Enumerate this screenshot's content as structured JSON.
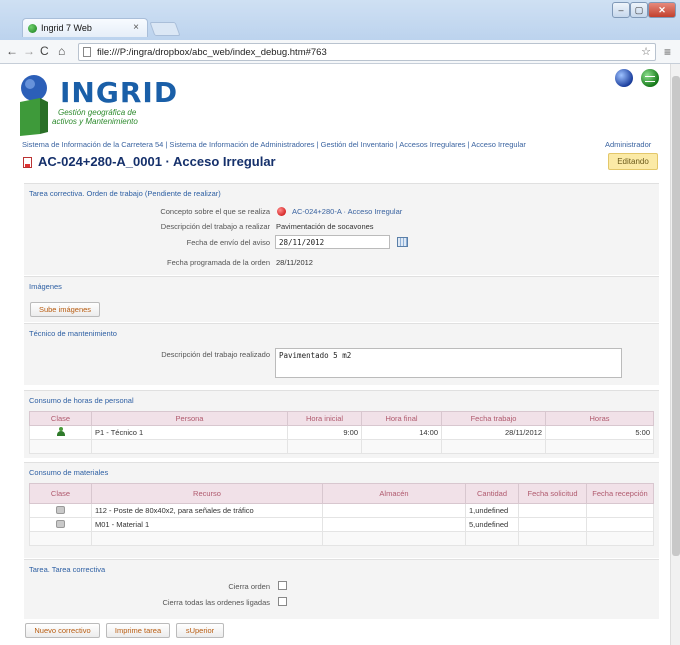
{
  "browser": {
    "tab_title": "Ingrid 7 Web",
    "tab_close": "×",
    "url": "file:///P:/ingra/dropbox/abc_web/index_debug.htm#763",
    "window_min": "–",
    "window_max": "▢",
    "window_close": "✕"
  },
  "header": {
    "logo_text": "INGRID",
    "logo_sub1": "Gestión geográfica de",
    "logo_sub2": "activos y Mantenimiento",
    "breadcrumb": "Sistema de Información de la Carretera 54 | Sistema de Información de Administradores | Gestión del Inventario | Accesos Irregulares | Acceso Irregular",
    "user": "Administrador",
    "title": "AC-024+280-A_0001 · Acceso Irregular",
    "status": "Editando"
  },
  "tarea": {
    "section_title": "Tarea correctiva. Orden de trabajo (Pendiente de realizar)",
    "concepto_label": "Concepto sobre el que se realiza",
    "concepto_value": "AC-024+280-A · Acceso Irregular",
    "descripcion_label": "Descripción del trabajo a realizar",
    "descripcion_value": "Pavimentación de socavones",
    "fecha_envio_label": "Fecha de envío del aviso",
    "fecha_envio_value": "28/11/2012",
    "fecha_prog_label": "Fecha programada de la orden",
    "fecha_prog_value": "28/11/2012"
  },
  "imagenes": {
    "section_title": "Imágenes",
    "upload_button": "Sube imágenes"
  },
  "tecnico": {
    "section_title": "Técnico de mantenimiento",
    "descripcion_label": "Descripción del trabajo realizado",
    "descripcion_value": "Pavimentado 5 m2"
  },
  "horas": {
    "section_title": "Consumo de horas de personal",
    "columns": [
      "Clase",
      "Persona",
      "Hora inicial",
      "Hora final",
      "Fecha trabajo",
      "Horas"
    ],
    "rows": [
      {
        "clase_icon": "person-icon",
        "persona": "P1 - Técnico 1",
        "hora_inicial": "9:00",
        "hora_final": "14:00",
        "fecha": "28/11/2012",
        "horas": "5:00"
      }
    ]
  },
  "materiales": {
    "section_title": "Consumo de materiales",
    "columns": [
      "Clase",
      "Recurso",
      "Almacén",
      "Cantidad",
      "Fecha solicitud",
      "Fecha recepción"
    ],
    "rows": [
      {
        "clase_icon": "box-icon",
        "recurso": "112 - Poste de 80x40x2, para señales de tráfico",
        "almacen": "",
        "cantidad": "1,undefined"
      },
      {
        "clase_icon": "box-icon",
        "recurso": "M01 - Material 1",
        "almacen": "",
        "cantidad": "5,undefined"
      }
    ]
  },
  "cierre": {
    "section_title": "Tarea. Tarea correctiva",
    "cierra_orden_label": "Cierra orden",
    "cierra_todas_label": "Cierra todas las ordenes ligadas"
  },
  "footer": {
    "nuevo_button": "Nuevo correctivo",
    "imprime_button": "Imprime tarea",
    "superior_button": "sUperior"
  },
  "colors": {
    "accent_blue": "#2d5fa3",
    "title_navy": "#15306b",
    "status_yellow": "#fbeaa6",
    "button_text": "#b85c10",
    "table_header_bg": "#f1e1e8"
  }
}
